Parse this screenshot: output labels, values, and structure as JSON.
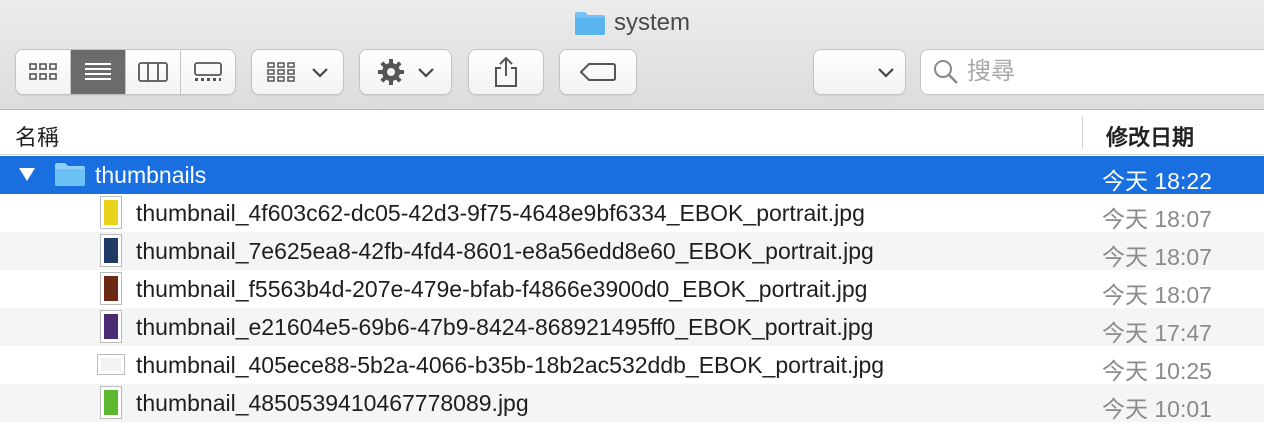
{
  "window": {
    "title": "system"
  },
  "toolbar": {
    "view_modes": [
      "icon-view",
      "list-view",
      "column-view",
      "gallery-view"
    ],
    "active_view": "list-view",
    "group_button": "group-icon",
    "action_button": "gear-icon",
    "share_button": "share-icon",
    "tag_button": "tag-icon",
    "search_placeholder": "搜尋"
  },
  "columns": {
    "name": "名稱",
    "date_modified": "修改日期"
  },
  "folder": {
    "name": "thumbnails",
    "date": "今天 18:22"
  },
  "files": [
    {
      "name": "thumbnail_4f603c62-dc05-42d3-9f75-4648e9bf6334_EBOK_portrait.jpg",
      "date": "今天 18:07",
      "thumb_color": "#e8d21c"
    },
    {
      "name": "thumbnail_7e625ea8-42fb-4fd4-8601-e8a56edd8e60_EBOK_portrait.jpg",
      "date": "今天 18:07",
      "thumb_color": "#203a66"
    },
    {
      "name": "thumbnail_f5563b4d-207e-479e-bfab-f4866e3900d0_EBOK_portrait.jpg",
      "date": "今天 18:07",
      "thumb_color": "#6a2a14"
    },
    {
      "name": "thumbnail_e21604e5-69b6-47b9-8424-868921495ff0_EBOK_portrait.jpg",
      "date": "今天 17:47",
      "thumb_color": "#4a2a70"
    },
    {
      "name": "thumbnail_405ece88-5b2a-4066-b35b-18b2ac532ddb_EBOK_portrait.jpg",
      "date": "今天 10:25",
      "thumb_color": "#f2f2f2"
    },
    {
      "name": "thumbnail_4850539410467778089.jpg",
      "date": "今天 10:01",
      "thumb_color": "#5cb82e"
    }
  ],
  "colors": {
    "selection": "#1a6fe0",
    "folder": "#5ab4f0"
  }
}
